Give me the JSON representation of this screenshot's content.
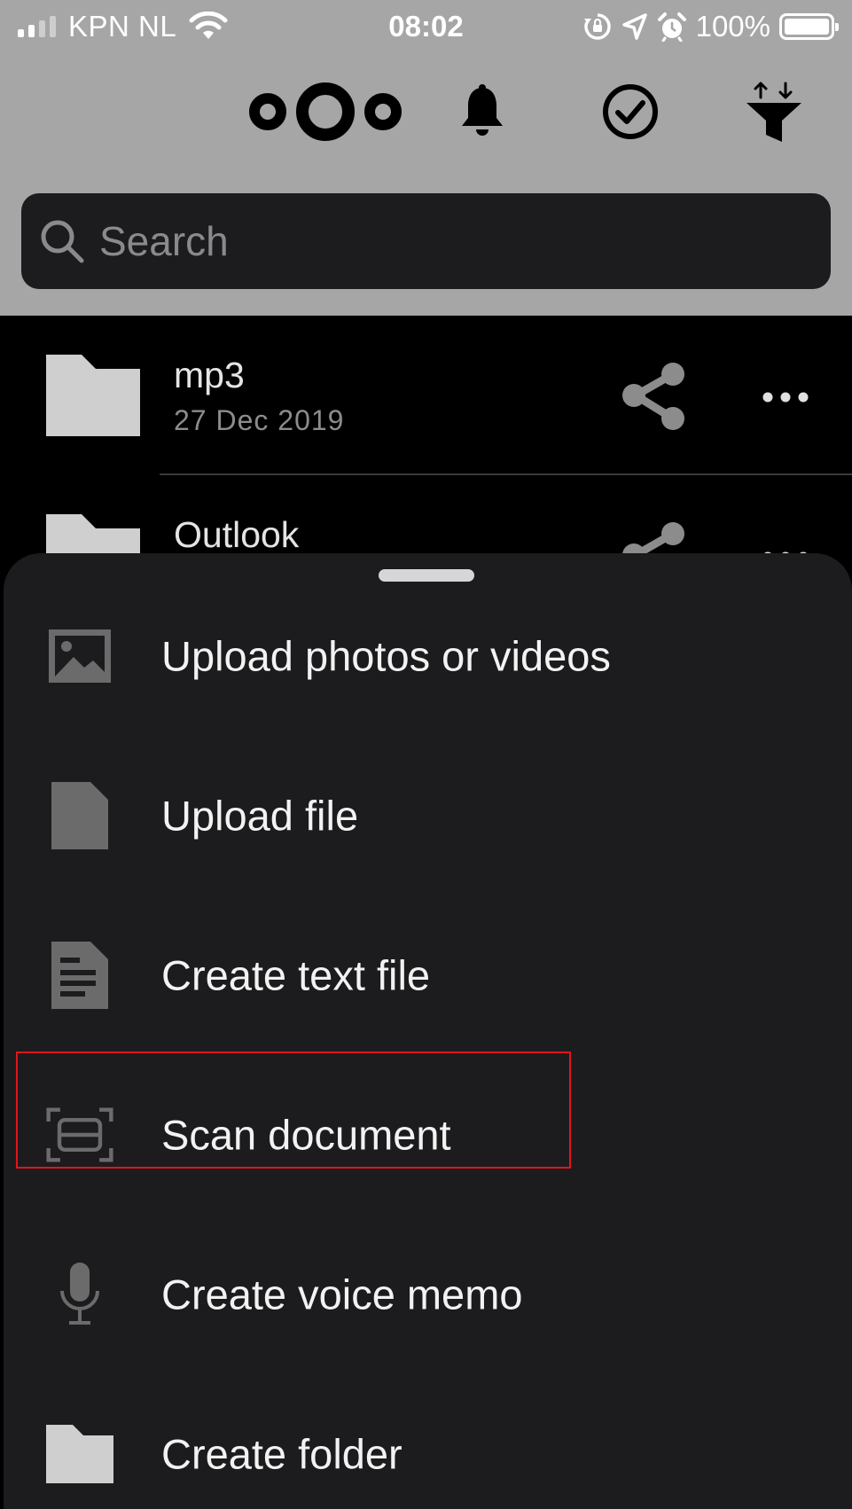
{
  "status_bar": {
    "carrier": "KPN NL",
    "time": "08:02",
    "battery": "100%",
    "signal_bars_filled": 2,
    "signal_bars_total": 4
  },
  "header": {
    "search_placeholder": "Search"
  },
  "files": [
    {
      "name": "mp3",
      "date": "27 Dec 2019"
    },
    {
      "name": "Outlook",
      "date": ""
    }
  ],
  "menu": {
    "items": [
      {
        "label": "Upload photos or videos",
        "icon": "image-icon"
      },
      {
        "label": "Upload file",
        "icon": "file-icon"
      },
      {
        "label": "Create text file",
        "icon": "text-file-icon"
      },
      {
        "label": "Scan document",
        "icon": "scan-icon"
      },
      {
        "label": "Create voice memo",
        "icon": "microphone-icon"
      },
      {
        "label": "Create folder",
        "icon": "folder-icon"
      }
    ]
  },
  "colors": {
    "header_bg": "#a6a6a6",
    "sheet_bg": "#1c1c1e",
    "highlight": "#e3141b"
  }
}
